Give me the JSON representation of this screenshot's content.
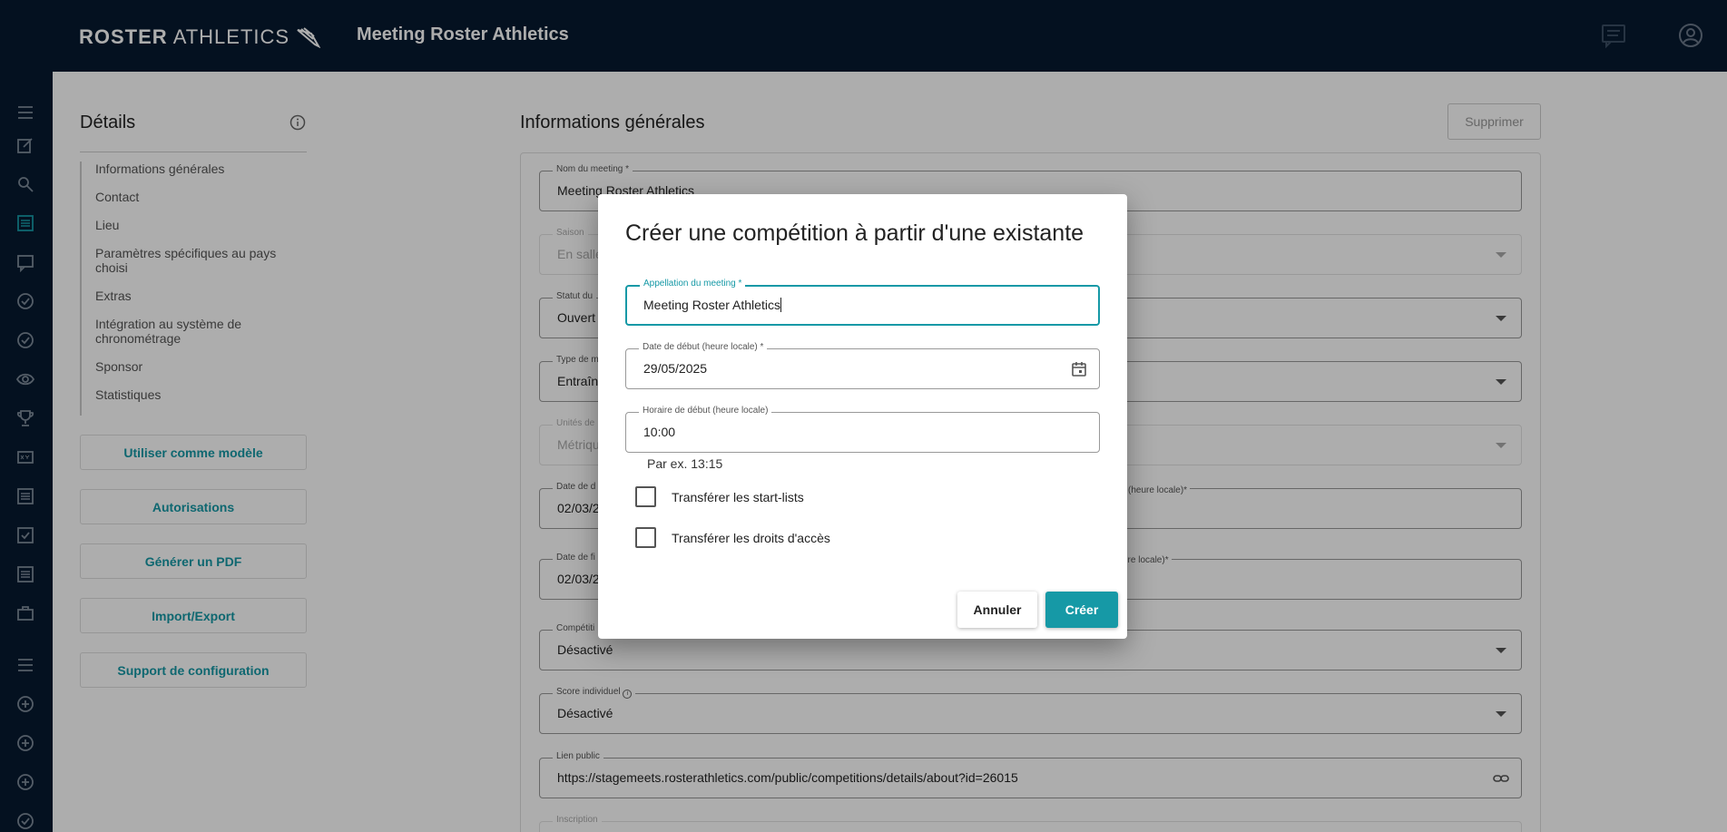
{
  "header": {
    "logo_bold": "ROSTER",
    "logo_light": "ATHLETICS",
    "app_title": "Meeting Roster Athletics",
    "icons": [
      "chat-icon",
      "account-icon"
    ]
  },
  "rail": {
    "icons": [
      "menu-icon",
      "edit-icon",
      "search-icon",
      "list-icon",
      "chat-icon",
      "check-circle-icon",
      "check-circle-icon",
      "eye-icon",
      "trophy-icon",
      "xyz-icon",
      "list-alt-icon",
      "checkbox-icon",
      "list-icon",
      "briefcase-icon",
      "menu-icon",
      "add-circle-icon",
      "add-circle-icon",
      "add-circle-icon",
      "check-circle-icon"
    ]
  },
  "details": {
    "title": "Détails",
    "nav": [
      "Informations générales",
      "Contact",
      "Lieu",
      "Paramètres spécifiques au pays choisi",
      "Extras",
      "Intégration au système de chronométrage",
      "Sponsor",
      "Statistiques"
    ],
    "buttons": [
      "Utiliser comme modèle",
      "Autorisations",
      "Générer un PDF",
      "Import/Export",
      "Support de configuration"
    ]
  },
  "general": {
    "title": "Informations générales",
    "delete_label": "Supprimer",
    "fields": {
      "name_label": "Nom du meeting *",
      "name_value": "Meeting Roster Athletics",
      "season_label": "Saison",
      "season_value": "En salle",
      "status_label": "Statut du",
      "status_value": "Ouvert",
      "type_label": "Type de m",
      "type_value": "Entraîne",
      "units_label": "Unités de",
      "units_value": "Métrique",
      "start_date_label": "Date de d",
      "start_date_value": "02/03/2",
      "start_time_right_label": "(heure locale)*",
      "end_date_label": "Date de fi",
      "end_date_value": "02/03/2",
      "end_time_right_label": "ure locale)*",
      "competition_label": "Compétiti",
      "competition_value": "Désactivé",
      "score_label": "Score individuel",
      "score_value": "Désactivé",
      "public_link_label": "Lien public",
      "public_link_value": "https://stagemeets.rosterathletics.com/public/competitions/details/about?id=26015",
      "inscription_label": "Inscription"
    }
  },
  "dialog": {
    "title": "Créer une compétition à partir d'une existante",
    "name_label": "Appellation du meeting *",
    "name_value": "Meeting Roster Athletics",
    "date_label": "Date de début (heure locale) *",
    "date_value": "29/05/2025",
    "time_label": "Horaire de début (heure locale)",
    "time_value": "10:00",
    "time_hint": "Par ex. 13:15",
    "checkbox_1": "Transférer les start-lists",
    "checkbox_1_checked": false,
    "checkbox_2": "Transférer les droits d'accès",
    "checkbox_2_checked": false,
    "cancel_label": "Annuler",
    "create_label": "Créer"
  },
  "colors": {
    "navy": "#061a30",
    "teal": "#1699a6"
  }
}
